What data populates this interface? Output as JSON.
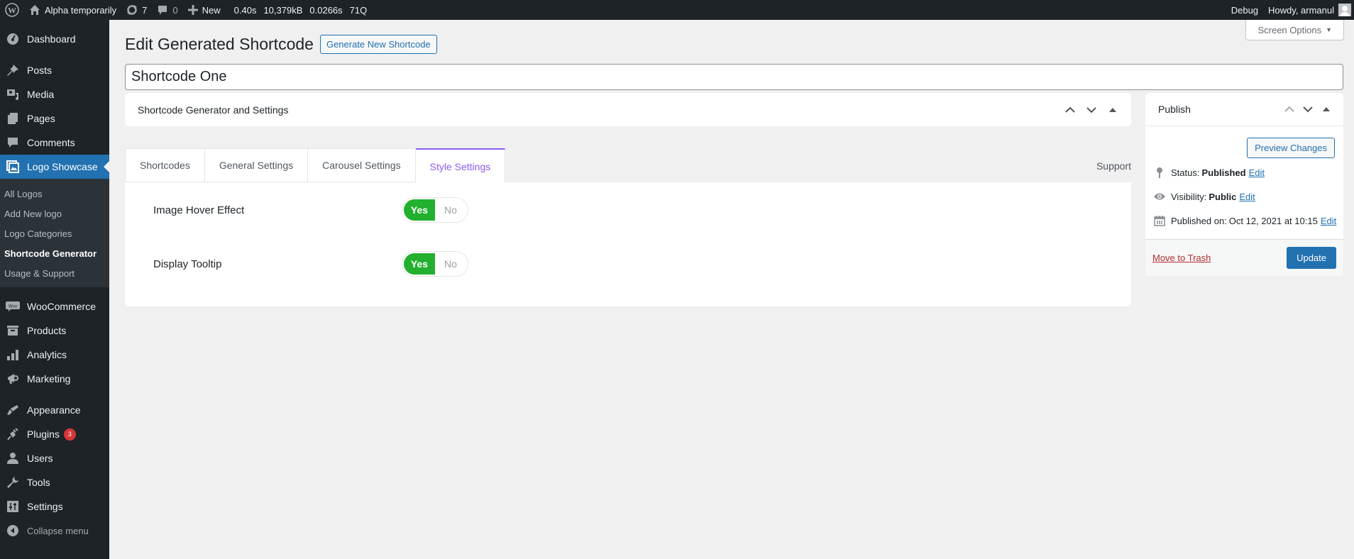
{
  "adminbar": {
    "site_name": "Alpha temporarily",
    "updates_count": "7",
    "comments_count": "0",
    "new_label": "New",
    "stats": [
      "0.40s",
      "10,379kB",
      "0.0266s",
      "71Q"
    ],
    "debug_label": "Debug",
    "greeting": "Howdy, armanul"
  },
  "sidebar": {
    "items": [
      {
        "label": "Dashboard",
        "icon": "dashboard-icon"
      },
      {
        "label": "Posts",
        "icon": "pin-icon"
      },
      {
        "label": "Media",
        "icon": "media-icon"
      },
      {
        "label": "Pages",
        "icon": "pages-icon"
      },
      {
        "label": "Comments",
        "icon": "comment-icon"
      },
      {
        "label": "Logo Showcase",
        "icon": "logo-showcase-icon",
        "active": true
      },
      {
        "label": "WooCommerce",
        "icon": "woo-icon"
      },
      {
        "label": "Products",
        "icon": "archive-icon"
      },
      {
        "label": "Analytics",
        "icon": "bar-chart-icon"
      },
      {
        "label": "Marketing",
        "icon": "megaphone-icon"
      },
      {
        "label": "Appearance",
        "icon": "brush-icon"
      },
      {
        "label": "Plugins",
        "icon": "plug-icon",
        "badge": "3"
      },
      {
        "label": "Users",
        "icon": "user-icon"
      },
      {
        "label": "Tools",
        "icon": "wrench-icon"
      },
      {
        "label": "Settings",
        "icon": "sliders-icon"
      }
    ],
    "submenu": [
      "All Logos",
      "Add New logo",
      "Logo Categories",
      "Shortcode Generator",
      "Usage & Support"
    ],
    "current_submenu": "Shortcode Generator",
    "collapse_label": "Collapse menu"
  },
  "header": {
    "screen_options": "Screen Options",
    "title": "Edit Generated Shortcode",
    "add_new": "Generate New Shortcode",
    "post_title": "Shortcode One"
  },
  "metabox": {
    "title": "Shortcode Generator and Settings"
  },
  "tabs": {
    "items": [
      "Shortcodes",
      "General Settings",
      "Carousel Settings",
      "Style Settings"
    ],
    "active": "Style Settings",
    "support": "Support",
    "accent": "#8b5cf6"
  },
  "settings": [
    {
      "label": "Image Hover Effect",
      "yes": "Yes",
      "no": "No",
      "value": "Yes"
    },
    {
      "label": "Display Tooltip",
      "yes": "Yes",
      "no": "No",
      "value": "Yes"
    }
  ],
  "publish": {
    "title": "Publish",
    "preview": "Preview Changes",
    "status_label": "Status:",
    "status_value": "Published",
    "visibility_label": "Visibility:",
    "visibility_value": "Public",
    "published_label": "Published on:",
    "published_value": "Oct 12, 2021 at 10:15",
    "edit_label": "Edit",
    "trash": "Move to Trash",
    "update": "Update"
  },
  "colors": {
    "admin_dark": "#1d2327",
    "primary": "#2271b1",
    "toggle_on": "#22b02e",
    "danger": "#b32d2e"
  }
}
